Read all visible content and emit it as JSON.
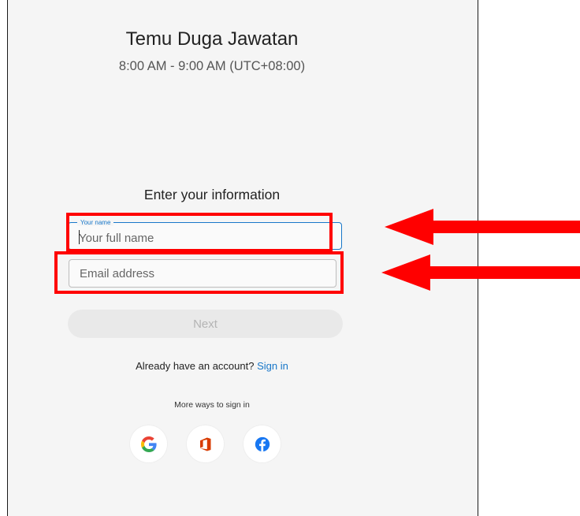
{
  "meeting": {
    "title": "Temu Duga Jawatan",
    "time": "8:00 AM - 9:00 AM (UTC+08:00)"
  },
  "form": {
    "heading": "Enter your information",
    "name_label": "Your name",
    "name_placeholder": "Your full name",
    "name_value": "",
    "email_placeholder": "Email address",
    "email_value": "",
    "next_label": "Next",
    "next_enabled": false
  },
  "account": {
    "prompt": "Already have an account?",
    "sign_in_label": "Sign in"
  },
  "alt_signin": {
    "heading": "More ways to sign in",
    "providers": [
      "google-icon",
      "office-icon",
      "facebook-icon"
    ]
  },
  "annotations": {
    "color": "#ff0000",
    "targets": [
      "name-field",
      "email-field"
    ]
  },
  "colors": {
    "panel_bg": "#f5f5f5",
    "accent": "#1877c9",
    "button_disabled_bg": "#e9e9e9",
    "annotation": "#ff0000"
  }
}
